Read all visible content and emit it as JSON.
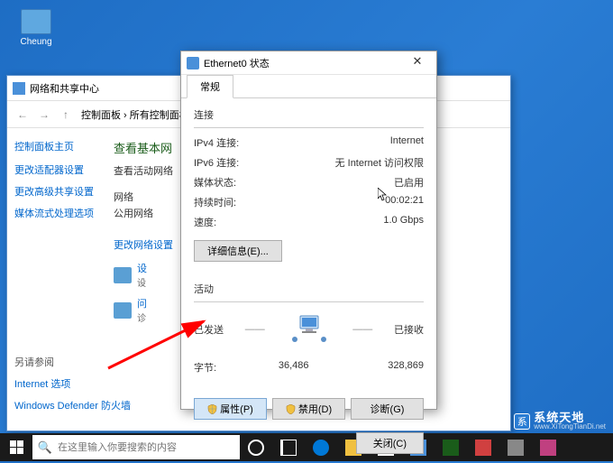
{
  "desktop": {
    "icon_label": "Cheung"
  },
  "cp": {
    "title": "网络和共享中心",
    "nav_back": "←",
    "nav_fwd": "→",
    "nav_up": "↑",
    "path1": "控制面板",
    "path2": "所有控制面板",
    "sidebar": {
      "home": "控制面板主页",
      "links": [
        "更改适配器设置",
        "更改高级共享设置",
        "媒体流式处理选项"
      ],
      "bottom_heading": "另请参阅",
      "bottom_links": [
        "Internet 选项",
        "Windows Defender 防火墙"
      ]
    },
    "main": {
      "heading": "查看基本网",
      "sub": "查看活动网络",
      "net_label": "网络",
      "net_type": "公用网络",
      "change_heading": "更改网络设置",
      "set1": "设",
      "set1_sub": "设",
      "set2": "问",
      "set2_sub": "诊"
    }
  },
  "eth": {
    "title": "Ethernet0 状态",
    "tab": "常规",
    "section_conn": "连接",
    "rows": {
      "ipv4_label": "IPv4 连接:",
      "ipv4_value": "Internet",
      "ipv6_label": "IPv6 连接:",
      "ipv6_value": "无 Internet 访问权限",
      "media_label": "媒体状态:",
      "media_value": "已启用",
      "duration_label": "持续时间:",
      "duration_value": "00:02:21",
      "speed_label": "速度:",
      "speed_value": "1.0 Gbps"
    },
    "details_btn": "详细信息(E)...",
    "section_activity": "活动",
    "sent_label": "已发送",
    "recv_label": "已接收",
    "bytes_label": "字节:",
    "bytes_sent": "36,486",
    "bytes_recv": "328,869",
    "btn_props": "属性(P)",
    "btn_disable": "禁用(D)",
    "btn_diag": "诊断(G)",
    "btn_close": "关闭(C)"
  },
  "taskbar": {
    "search_placeholder": "在这里输入你要搜索的内容"
  },
  "watermark": {
    "main": "系统天地",
    "url": "www.XiTongTianDi.net"
  }
}
